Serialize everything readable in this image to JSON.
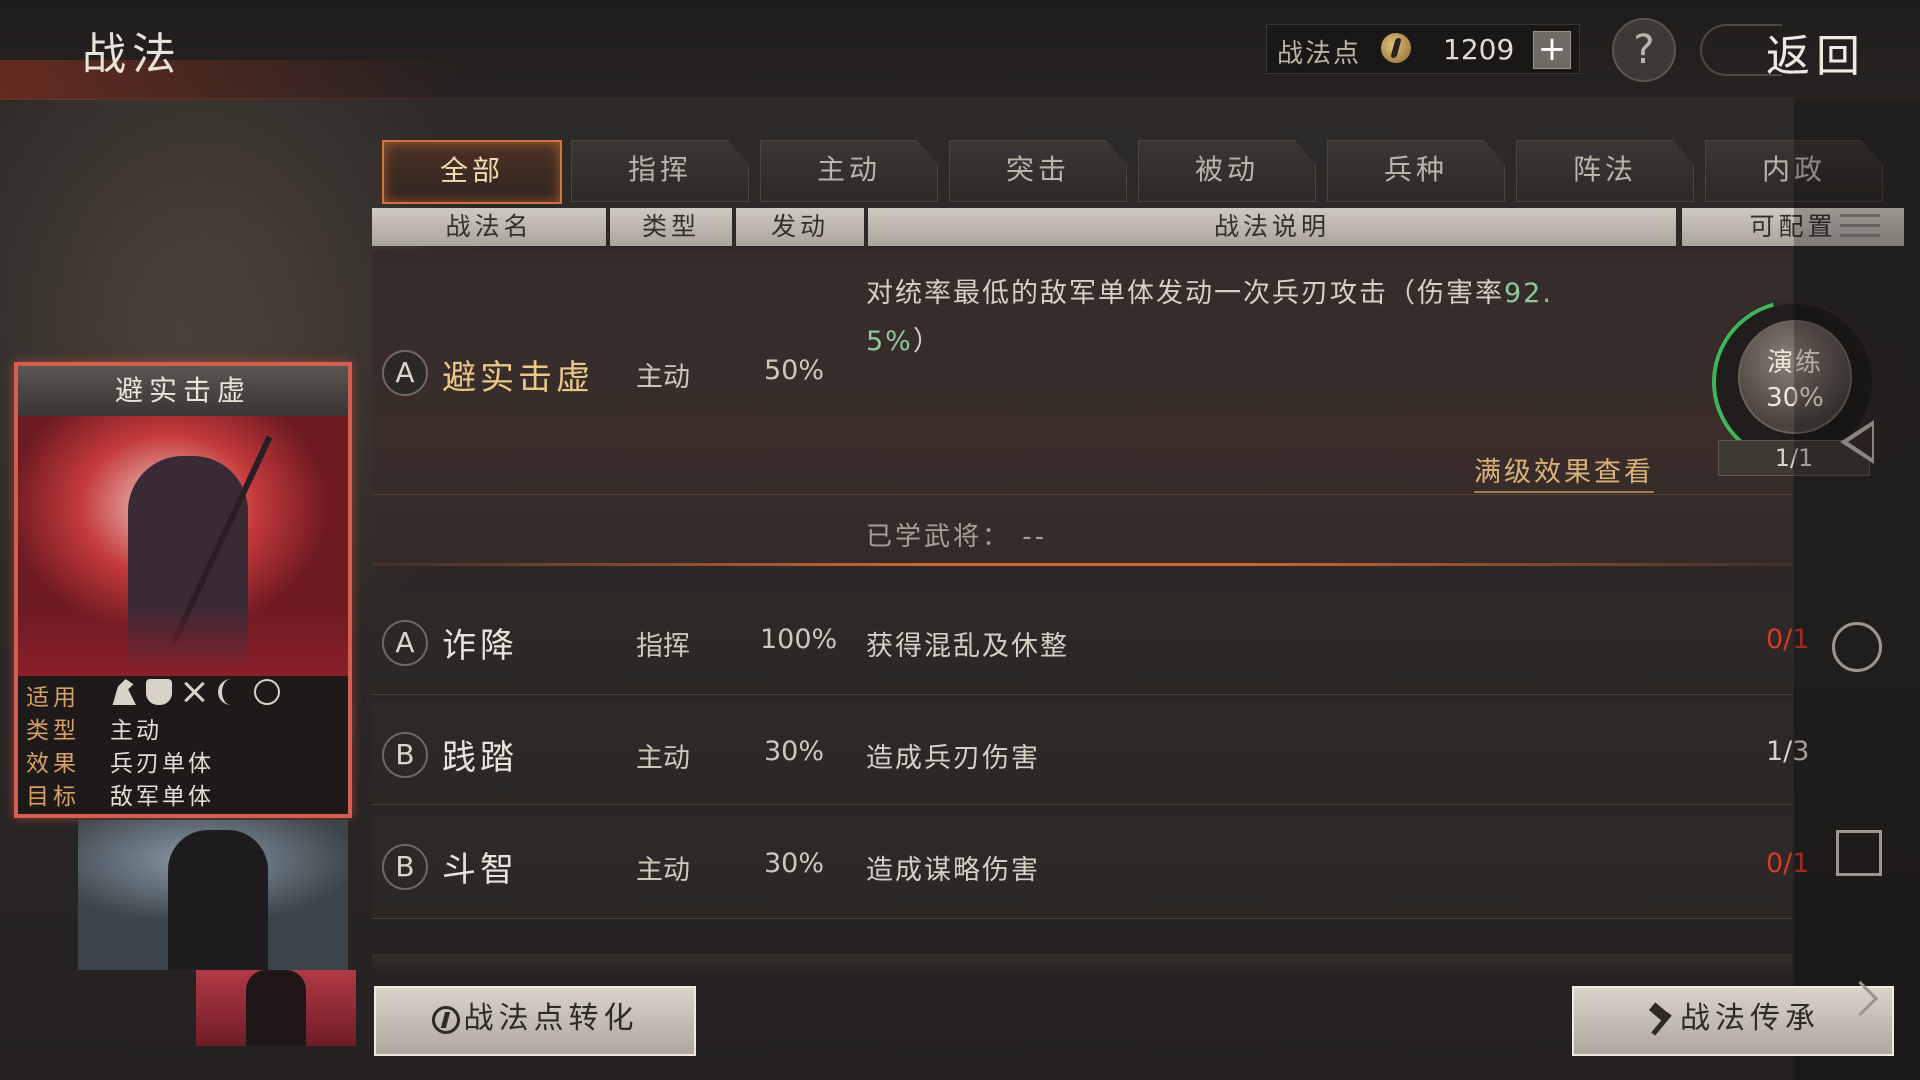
{
  "header": {
    "title": "战法",
    "points_label": "战法点",
    "points_value": "1209",
    "plus_label": "+",
    "help_label": "?",
    "back_label": "返回"
  },
  "tabs": [
    {
      "label": "全部",
      "active": true
    },
    {
      "label": "指挥",
      "active": false
    },
    {
      "label": "主动",
      "active": false
    },
    {
      "label": "突击",
      "active": false
    },
    {
      "label": "被动",
      "active": false
    },
    {
      "label": "兵种",
      "active": false
    },
    {
      "label": "阵法",
      "active": false
    },
    {
      "label": "内政",
      "active": false
    }
  ],
  "columns": {
    "name": "战法名",
    "type": "类型",
    "trigger": "发动",
    "desc": "战法说明",
    "config": "可配置"
  },
  "expanded": {
    "grade": "A",
    "name": "避实击虚",
    "type": "主动",
    "rate": "50%",
    "desc_prefix": "对统率最低的敌军单体发动一次兵刃攻击（伤害率",
    "desc_value1": "92.",
    "desc_value2": "5%",
    "desc_suffix": "）",
    "link": "满级效果查看",
    "learned_label": "已学武将：",
    "learned_value": "--",
    "practice_label": "演练",
    "practice_pct": "30%",
    "count": "1/1"
  },
  "rows": [
    {
      "grade": "A",
      "name": "诈降",
      "type": "指挥",
      "rate": "100%",
      "desc": "获得混乱及休整",
      "count": "0/1",
      "count_color": "red"
    },
    {
      "grade": "B",
      "name": "践踏",
      "type": "主动",
      "rate": "30%",
      "desc": "造成兵刃伤害",
      "count": "1/3",
      "count_color": "white"
    },
    {
      "grade": "B",
      "name": "斗智",
      "type": "主动",
      "rate": "30%",
      "desc": "造成谋略伤害",
      "count": "0/1",
      "count_color": "red"
    }
  ],
  "card": {
    "title": "避实击虚",
    "props": [
      {
        "key": "适用",
        "value": ""
      },
      {
        "key": "类型",
        "value": "主动"
      },
      {
        "key": "效果",
        "value": "兵刃单体"
      },
      {
        "key": "目标",
        "value": "敌军单体"
      }
    ],
    "troop_icons": [
      "cavalry-icon",
      "shield-icon",
      "crossed-spears-icon",
      "bow-icon",
      "wheel-icon"
    ]
  },
  "buttons": {
    "convert": "战法点转化",
    "inherit": "战法传承"
  },
  "colors": {
    "accent_orange": "#d06a36",
    "count_red": "#d8372e",
    "practice_green": "#3fb45a",
    "desc_green": "#8fc89a"
  }
}
